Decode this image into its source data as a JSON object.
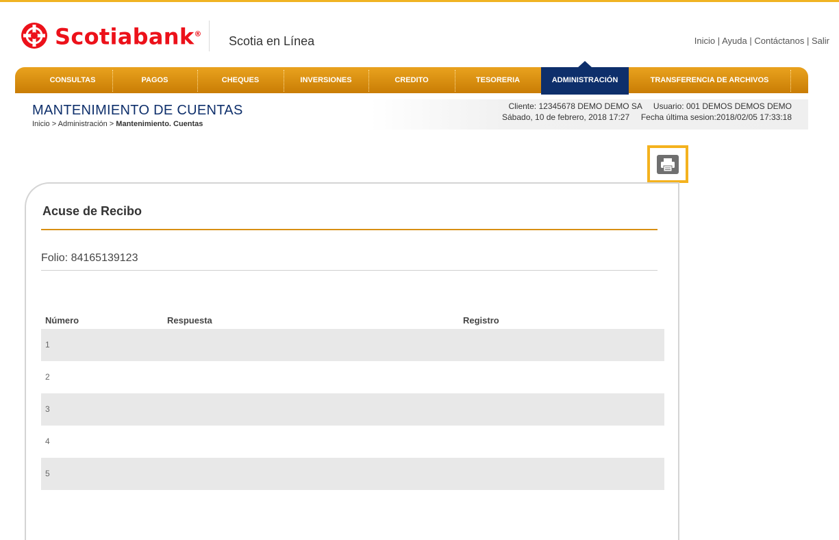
{
  "header": {
    "brand": "Scotiabank",
    "brand_mark": "®",
    "product": "Scotia en Línea",
    "links": [
      "Inicio",
      "Ayuda",
      "Contáctanos",
      "Salir"
    ],
    "link_separator": "|"
  },
  "nav": {
    "items": [
      "CONSULTAS",
      "PAGOS",
      "CHEQUES",
      "INVERSIONES",
      "CREDITO",
      "TESORERIA",
      "ADMINISTRACIÓN",
      "TRANSFERENCIA DE ARCHIVOS"
    ],
    "active": "ADMINISTRACIÓN"
  },
  "page": {
    "title": "MANTENIMIENTO DE CUENTAS",
    "breadcrumb": {
      "prefix": "Inicio > Administración > ",
      "current": "Mantenimiento. Cuentas"
    }
  },
  "session": {
    "cliente_label": "Cliente:",
    "cliente_value": "12345678",
    "cliente_name": "DEMO DEMO SA",
    "usuario_label": "Usuario:",
    "usuario_value": "001",
    "usuario_name": "DEMOS DEMOS DEMO",
    "date": "Sábado, 10 de febrero, 2018 17:27",
    "last_session_label": "Fecha última sesion:",
    "last_session_value": "2018/02/05 17:33:18"
  },
  "receipt": {
    "title": "Acuse de Recibo",
    "folio_label": "Folio:",
    "folio_value": "84165139123",
    "columns": [
      "Número",
      "Respuesta",
      "Registro"
    ],
    "rows": [
      {
        "numero": "1",
        "respuesta": "",
        "registro": ""
      },
      {
        "numero": "2",
        "respuesta": "",
        "registro": ""
      },
      {
        "numero": "3",
        "respuesta": "",
        "registro": ""
      },
      {
        "numero": "4",
        "respuesta": "",
        "registro": ""
      },
      {
        "numero": "5",
        "respuesta": "",
        "registro": ""
      }
    ]
  },
  "icons": {
    "logo": "scotiabank-globe-icon",
    "print": "printer-icon"
  },
  "colors": {
    "brand_red": "#ec111a",
    "nav_gold": "#e9a21e",
    "nav_active": "#0e2f6b",
    "highlight": "#f4b21e",
    "row_shade": "#e8e8e8"
  }
}
